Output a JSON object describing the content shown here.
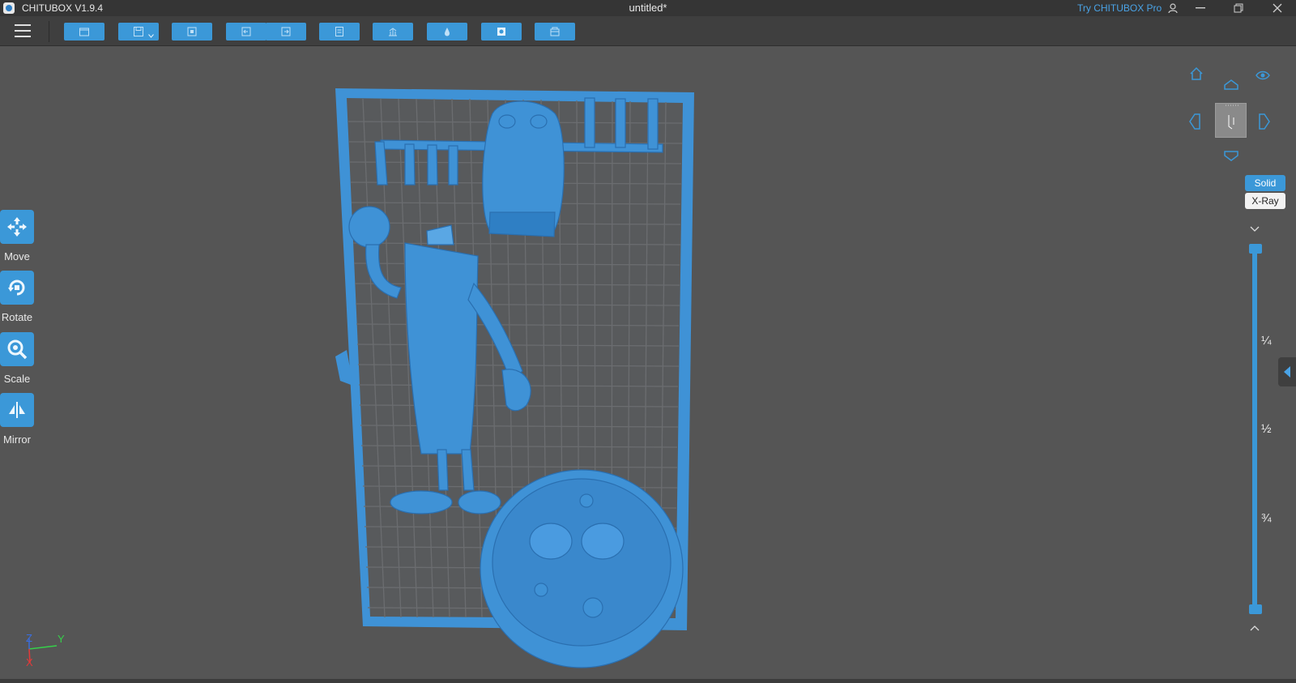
{
  "titlebar": {
    "app_name": "CHITUBOX V1.9.4",
    "document_title": "untitled*",
    "try_pro": "Try CHITUBOX Pro"
  },
  "toolbar": {
    "buttons": [
      "open-file",
      "save",
      "auto-layout",
      "undo",
      "redo",
      "print-settings",
      "supports",
      "hollow",
      "dig-hole",
      "slice"
    ]
  },
  "tools": {
    "move": "Move",
    "rotate": "Rotate",
    "scale": "Scale",
    "mirror": "Mirror"
  },
  "view": {
    "solid": "Solid",
    "xray": "X-Ray",
    "fractions": [
      "¼",
      "½",
      "¾"
    ]
  },
  "axes": {
    "x": "X",
    "y": "Y",
    "z": "Z"
  },
  "colors": {
    "accent": "#3b98d8",
    "model": "#3f92d6",
    "background": "#555555"
  }
}
